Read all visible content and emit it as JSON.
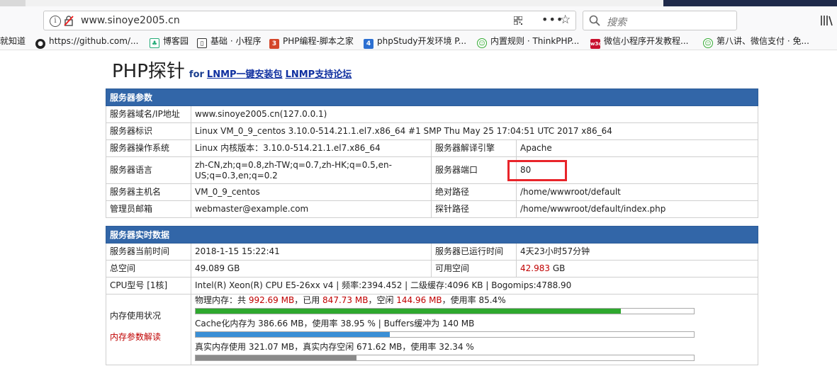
{
  "browser": {
    "url": "www.sinoye2005.cn",
    "search_placeholder": "搜索",
    "bookmarks": [
      {
        "label": "就知道",
        "icon": "none"
      },
      {
        "label": "https://github.com/...",
        "icon": "github-icon"
      },
      {
        "label": "博客园",
        "icon": "cnblogs-icon"
      },
      {
        "label": "基础 · 小程序",
        "icon": "book-icon"
      },
      {
        "label": "PHP编程-脚本之家",
        "icon": "jb51-icon"
      },
      {
        "label": "phpStudy开发环境 P...",
        "icon": "phpstudy-icon"
      },
      {
        "label": "内置规则 · ThinkPHP...",
        "icon": "thinkphp-icon"
      },
      {
        "label": "微信小程序开发教程...",
        "icon": "w3c-icon"
      },
      {
        "label": "第八讲、微信支付 · 免...",
        "icon": "thinkphp-icon"
      }
    ]
  },
  "page": {
    "title": "PHP探针",
    "for_text": "for",
    "link1": "LNMP一键安装包",
    "link2": "LNMP支持论坛"
  },
  "server_params": {
    "header": "服务器参数",
    "domain_label": "服务器域名/IP地址",
    "domain_value": "www.sinoye2005.cn(127.0.0.1)",
    "id_label": "服务器标识",
    "id_value": "Linux VM_0_9_centos 3.10.0-514.21.1.el7.x86_64 #1 SMP Thu May 25 17:04:51 UTC 2017 x86_64",
    "os_label": "服务器操作系统",
    "os_value": "Linux  内核版本：3.10.0-514.21.1.el7.x86_64",
    "engine_label": "服务器解译引擎",
    "engine_value": "Apache",
    "lang_label": "服务器语言",
    "lang_value": "zh-CN,zh;q=0.8,zh-TW;q=0.7,zh-HK;q=0.5,en-US;q=0.3,en;q=0.2",
    "port_label": "服务器端口",
    "port_value": "80",
    "host_label": "服务器主机名",
    "host_value": "VM_0_9_centos",
    "abspath_label": "绝对路径",
    "abspath_value": "/home/wwwroot/default",
    "email_label": "管理员邮箱",
    "email_value": "webmaster@example.com",
    "probe_label": "探针路径",
    "probe_value": "/home/wwwroot/default/index.php"
  },
  "realtime": {
    "header": "服务器实时数据",
    "time_label": "服务器当前时间",
    "time_value": "2018-1-15 15:22:41",
    "uptime_label": "服务器已运行时间",
    "uptime_value": "4天23小时57分钟",
    "total_label": "总空间",
    "total_value": "49.089 GB",
    "free_label": "可用空间",
    "free_num": "42.983",
    "free_unit": " GB",
    "cpu_label": "CPU型号 [1核]",
    "cpu_value": "Intel(R) Xeon(R) CPU E5-26xx v4 | 频率:2394.452 | 二级缓存:4096 KB | Bogomips:4788.90",
    "mem_label": "内存使用状况",
    "mem_help": "内存参数解读",
    "phys_prefix": "物理内存：共 ",
    "phys_total": "992.69 MB",
    "phys_used_prefix": "，已用 ",
    "phys_used": "847.73 MB",
    "phys_free_prefix": "，空闲 ",
    "phys_free": "144.96 MB",
    "phys_rate": "，使用率 85.4%",
    "phys_percent": 85.4,
    "cache_text": "Cache化内存为 386.66 MB，使用率 38.95 % | Buffers缓冲为 140 MB",
    "cache_percent": 38.95,
    "real_text": "真实内存使用 321.07 MB，真实内存空闲 671.62 MB，使用率 32.34 %",
    "real_percent": 32.34,
    "colors": {
      "phys": "#2ea82e",
      "cache": "#3a8fd6",
      "real": "#8a8a8a"
    }
  }
}
